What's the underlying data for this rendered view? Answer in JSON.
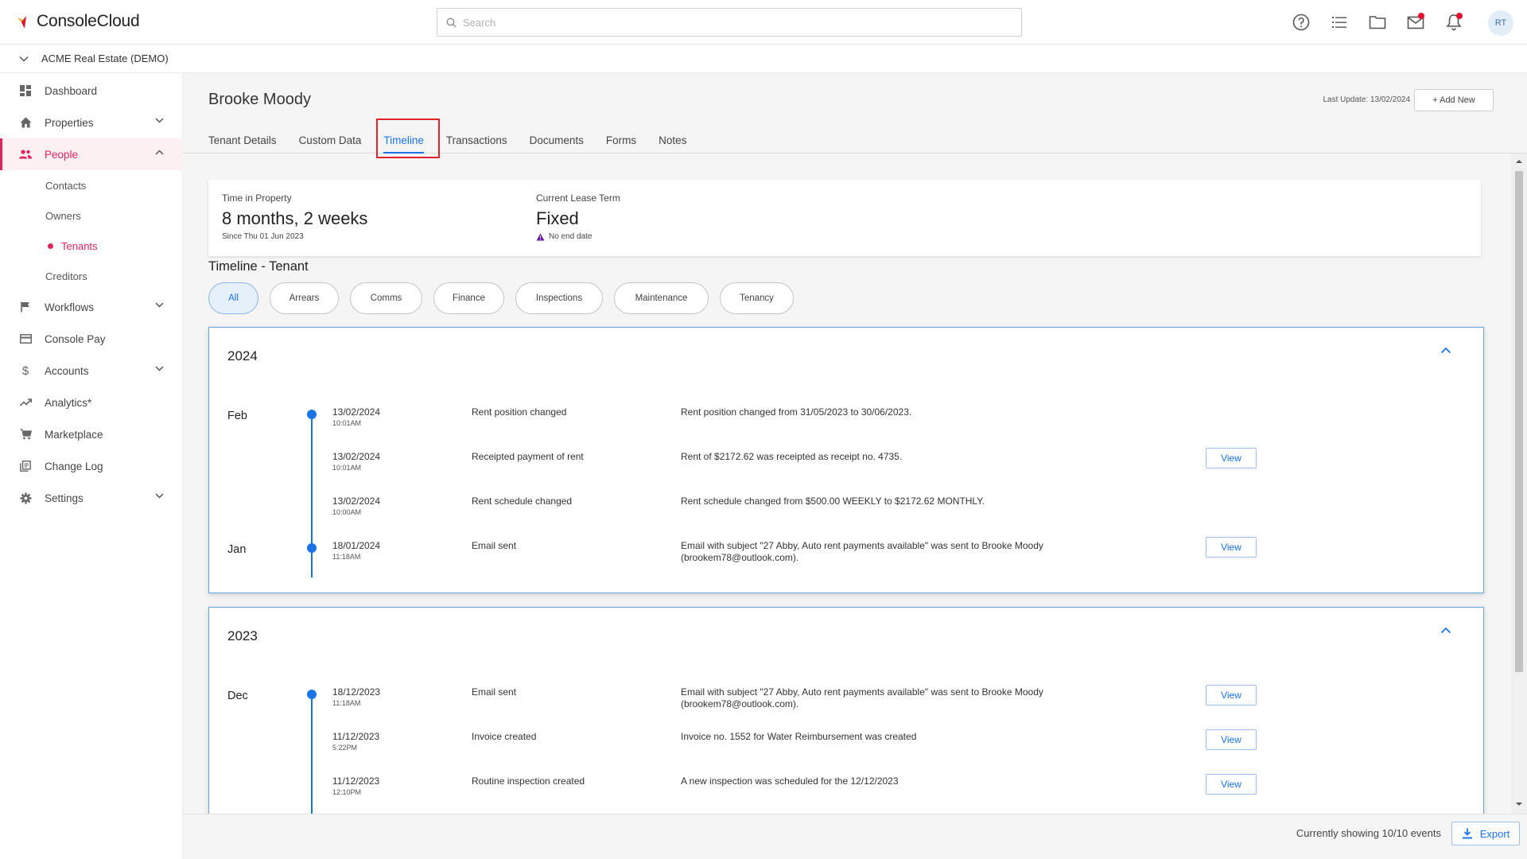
{
  "app": {
    "brand": "ConsoleCloud",
    "org": "ACME Real Estate (DEMO)"
  },
  "search": {
    "placeholder": "Search"
  },
  "topbar": {
    "avatar_initials": "RT"
  },
  "sidebar": {
    "items": [
      {
        "label": "Dashboard",
        "icon": "dashboard-icon"
      },
      {
        "label": "Properties",
        "icon": "home-icon"
      },
      {
        "label": "People",
        "icon": "people-icon"
      },
      {
        "label": "Contacts"
      },
      {
        "label": "Owners"
      },
      {
        "label": "Tenants"
      },
      {
        "label": "Creditors"
      },
      {
        "label": "Workflows",
        "icon": "flag-icon"
      },
      {
        "label": "Console Pay",
        "icon": "card-icon"
      },
      {
        "label": "Accounts",
        "icon": "dollar-icon"
      },
      {
        "label": "Analytics*",
        "icon": "trend-icon"
      },
      {
        "label": "Marketplace",
        "icon": "cart-icon"
      },
      {
        "label": "Change Log",
        "icon": "log-icon"
      },
      {
        "label": "Settings",
        "icon": "gear-icon"
      }
    ]
  },
  "page": {
    "name": "Brooke Moody",
    "last_update": "Last Update: 13/02/2024",
    "add_new": "+ Add New",
    "tabs": [
      "Tenant Details",
      "Custom Data",
      "Timeline",
      "Transactions",
      "Documents",
      "Forms",
      "Notes"
    ],
    "active_tab": "Timeline"
  },
  "summary": {
    "time_label": "Time in Property",
    "time_value": "8 months, 2 weeks",
    "time_sub": "Since Thu 01 Jun 2023",
    "lease_label": "Current Lease Term",
    "lease_value": "Fixed",
    "lease_sub": "No end date"
  },
  "timeline": {
    "title": "Timeline - Tenant",
    "filters": [
      "All",
      "Arrears",
      "Comms",
      "Finance",
      "Inspections",
      "Maintenance",
      "Tenancy"
    ],
    "active_filter": "All",
    "years": [
      {
        "year": "2024",
        "events": [
          {
            "month": "Feb",
            "date": "13/02/2024",
            "time": "10:01AM",
            "type": "Rent position changed",
            "desc": "Rent position changed from 31/05/2023 to 30/06/2023.",
            "view": ""
          },
          {
            "month": "",
            "date": "13/02/2024",
            "time": "10:01AM",
            "type": "Receipted payment of rent",
            "desc": "Rent of $2172.62 was receipted as receipt no. 4735.",
            "view": "View"
          },
          {
            "month": "",
            "date": "13/02/2024",
            "time": "10:00AM",
            "type": "Rent schedule changed",
            "desc": "Rent schedule changed from $500.00 WEEKLY to $2172.62 MONTHLY.",
            "view": ""
          },
          {
            "month": "Jan",
            "date": "18/01/2024",
            "time": "11:18AM",
            "type": "Email sent",
            "desc": "Email with subject \"27 Abby, Auto rent payments available\" was sent to Brooke Moody (brookem78@outlook.com).",
            "view": "View"
          }
        ]
      },
      {
        "year": "2023",
        "events": [
          {
            "month": "Dec",
            "date": "18/12/2023",
            "time": "11:18AM",
            "type": "Email sent",
            "desc": "Email with subject \"27 Abby, Auto rent payments available\" was sent to Brooke Moody (brookem78@outlook.com).",
            "view": "View"
          },
          {
            "month": "",
            "date": "11/12/2023",
            "time": "5:22PM",
            "type": "Invoice created",
            "desc": "Invoice no. 1552 for Water Reimbursement was created",
            "view": "View"
          },
          {
            "month": "",
            "date": "11/12/2023",
            "time": "12:10PM",
            "type": "Routine inspection created",
            "desc": "A new inspection was scheduled for the 12/12/2023",
            "view": "View"
          }
        ]
      }
    ]
  },
  "footer": {
    "showing": "Currently showing 10/10 events",
    "export": "Export"
  },
  "colors": {
    "accent": "#1a73e8",
    "active_nav": "#e0245e",
    "highlight": "#e1232b"
  }
}
